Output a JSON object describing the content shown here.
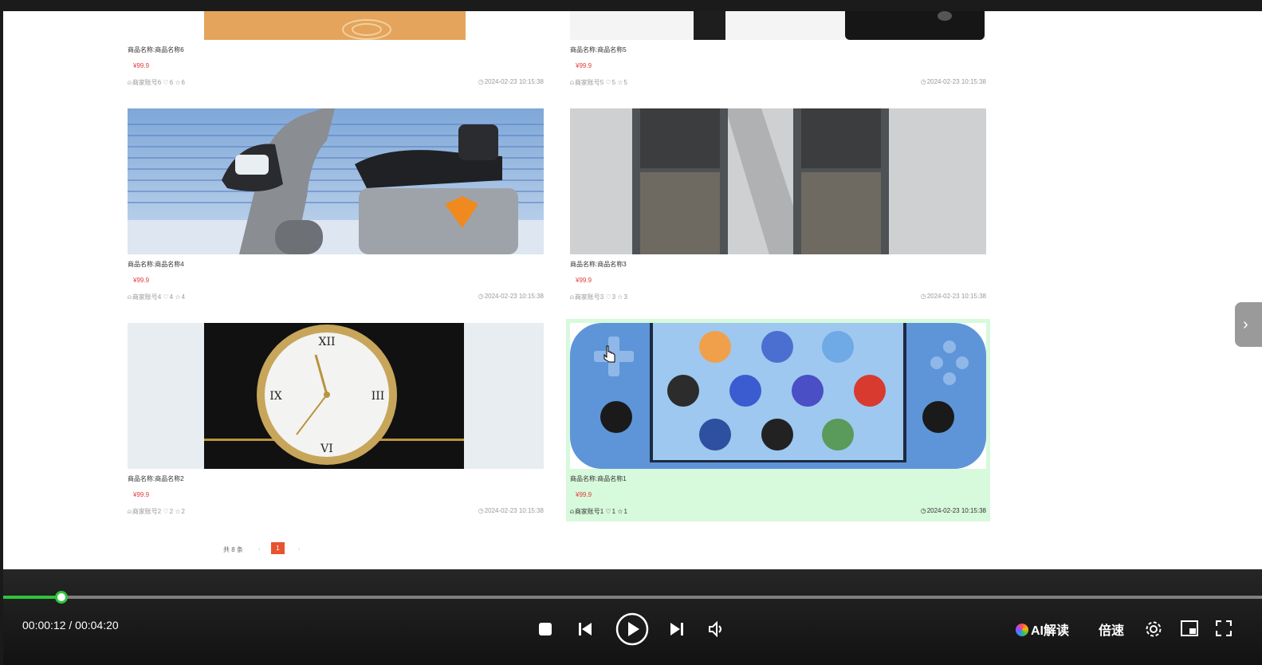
{
  "products": [
    {
      "name": "商品名称:商品名称6",
      "price": "¥99.9",
      "seller": "商家账号6",
      "likes": "6",
      "favorites": "6",
      "date": "2024-02-23 10:15:38"
    },
    {
      "name": "商品名称:商品名称5",
      "price": "¥99.9",
      "seller": "商家账号5",
      "likes": "5",
      "favorites": "5",
      "date": "2024-02-23 10:15:38"
    },
    {
      "name": "商品名称:商品名称4",
      "price": "¥99.9",
      "seller": "商家账号4",
      "likes": "4",
      "favorites": "4",
      "date": "2024-02-23 10:15:38"
    },
    {
      "name": "商品名称:商品名称3",
      "price": "¥99.9",
      "seller": "商家账号3",
      "likes": "3",
      "favorites": "3",
      "date": "2024-02-23 10:15:38"
    },
    {
      "name": "商品名称:商品名称2",
      "price": "¥99.9",
      "seller": "商家账号2",
      "likes": "2",
      "favorites": "2",
      "date": "2024-02-23 10:15:38"
    },
    {
      "name": "商品名称:商品名称1",
      "price": "¥99.9",
      "seller": "商家账号1",
      "likes": "1",
      "favorites": "1",
      "date": "2024-02-23 10:15:38"
    }
  ],
  "pagination": {
    "total": "共 8 条",
    "prev": "‹",
    "current": "1",
    "next": "›"
  },
  "side_tab": {
    "glyph": "›"
  },
  "player": {
    "time": "00:00:12 / 00:04:20",
    "progress": 0.046,
    "ai_label": "AI解读",
    "speed_label": "倍速",
    "accent": "#2fc43b"
  },
  "colors": {
    "price": "#e4393c",
    "hover_bg": "#d7f9dc",
    "page_active": "#e8532f"
  }
}
